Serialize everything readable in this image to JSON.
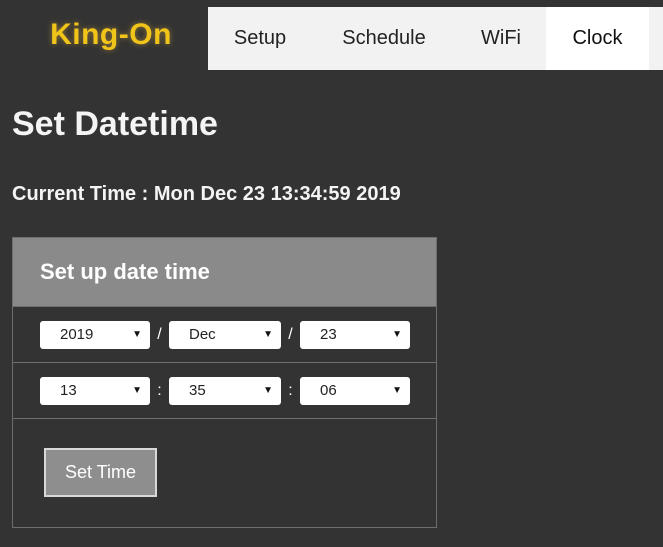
{
  "nav": {
    "brand": "King-On",
    "tabs": [
      {
        "label": "Setup",
        "active": false
      },
      {
        "label": "Schedule",
        "active": false
      },
      {
        "label": "WiFi",
        "active": false
      },
      {
        "label": "Clock",
        "active": true
      }
    ]
  },
  "page": {
    "title": "Set Datetime",
    "current_time_label": "Current Time :",
    "current_time_value": "Mon Dec 23 13:34:59 2019"
  },
  "form": {
    "header": "Set up date time",
    "date": {
      "year": "2019",
      "month": "Dec",
      "day": "23",
      "separator": "/"
    },
    "time": {
      "hour": "13",
      "minute": "35",
      "second": "06",
      "separator": ":"
    },
    "submit_label": "Set Time"
  },
  "icons": {
    "dropdown": "▼"
  },
  "colors": {
    "background": "#333333",
    "brand": "#f0c419",
    "panel_header": "#8a8a8a",
    "button": "#8e8e8e"
  }
}
